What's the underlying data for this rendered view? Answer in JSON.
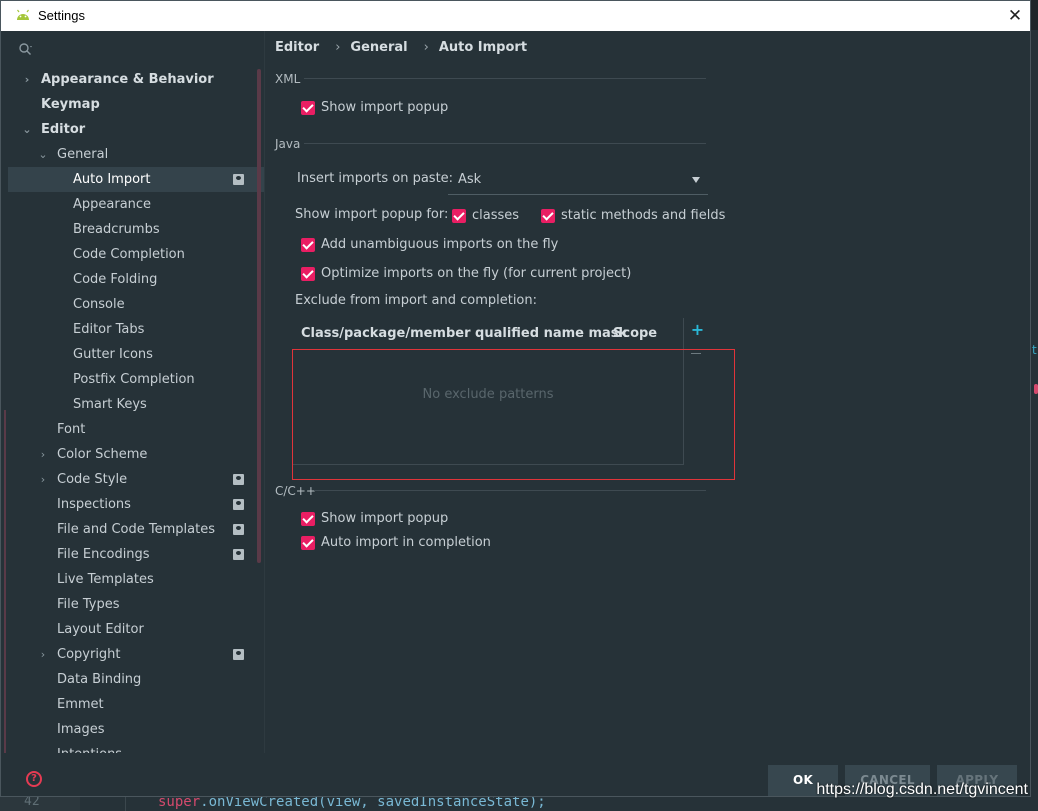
{
  "window": {
    "title": "Settings",
    "close_glyph": "✕"
  },
  "background": {
    "line_number": "42",
    "code_keyword": "super",
    "code_rest": ".onViewCreated(view, savedInstanceState);",
    "watermark": "https://blog.csdn.net/tgvincent",
    "right_peek_char": "t"
  },
  "sidebar": {
    "search_placeholder": "",
    "items": [
      {
        "label": "Appearance & Behavior",
        "level": 0,
        "arrow": "›",
        "bold": true
      },
      {
        "label": "Keymap",
        "level": 0,
        "arrow": "",
        "bold": true
      },
      {
        "label": "Editor",
        "level": 0,
        "arrow": "⌄",
        "bold": true
      },
      {
        "label": "General",
        "level": 1,
        "arrow": "⌄"
      },
      {
        "label": "Auto Import",
        "level": 2,
        "selected": true,
        "project": true
      },
      {
        "label": "Appearance",
        "level": 2
      },
      {
        "label": "Breadcrumbs",
        "level": 2
      },
      {
        "label": "Code Completion",
        "level": 2
      },
      {
        "label": "Code Folding",
        "level": 2
      },
      {
        "label": "Console",
        "level": 2
      },
      {
        "label": "Editor Tabs",
        "level": 2
      },
      {
        "label": "Gutter Icons",
        "level": 2
      },
      {
        "label": "Postfix Completion",
        "level": 2
      },
      {
        "label": "Smart Keys",
        "level": 2
      },
      {
        "label": "Font",
        "level": 1
      },
      {
        "label": "Color Scheme",
        "level": 1,
        "arrow": "›"
      },
      {
        "label": "Code Style",
        "level": 1,
        "arrow": "›",
        "project": true
      },
      {
        "label": "Inspections",
        "level": 1,
        "project": true
      },
      {
        "label": "File and Code Templates",
        "level": 1,
        "project": true
      },
      {
        "label": "File Encodings",
        "level": 1,
        "project": true
      },
      {
        "label": "Live Templates",
        "level": 1
      },
      {
        "label": "File Types",
        "level": 1
      },
      {
        "label": "Layout Editor",
        "level": 1
      },
      {
        "label": "Copyright",
        "level": 1,
        "arrow": "›",
        "project": true
      },
      {
        "label": "Data Binding",
        "level": 1
      },
      {
        "label": "Emmet",
        "level": 1
      },
      {
        "label": "Images",
        "level": 1
      },
      {
        "label": "Intentions",
        "level": 1
      }
    ]
  },
  "breadcrumb": {
    "parts": [
      "Editor",
      "General",
      "Auto Import"
    ],
    "separator": "›"
  },
  "xml": {
    "title": "XML",
    "show_import_popup": {
      "label": "Show import popup",
      "checked": true
    }
  },
  "java": {
    "title": "Java",
    "insert_imports_label": "Insert imports on paste:",
    "insert_imports_value": "Ask",
    "show_popup_for_label": "Show import popup for:",
    "classes": {
      "label": "classes",
      "checked": true
    },
    "static_methods": {
      "label": "static methods and fields",
      "checked": true
    },
    "add_unambiguous": {
      "label": "Add unambiguous imports on the fly",
      "checked": true
    },
    "optimize_imports": {
      "label": "Optimize imports on the fly (for current project)",
      "checked": true
    },
    "exclude_label": "Exclude from import and completion:",
    "table": {
      "columns": [
        "Class/package/member qualified name mask",
        "Scope"
      ],
      "empty_text": "No exclude patterns",
      "add_glyph": "+"
    }
  },
  "cpp": {
    "title": "C/C++",
    "show_import_popup": {
      "label": "Show import popup",
      "checked": true
    },
    "auto_import_completion": {
      "label": "Auto import in completion",
      "checked": true
    }
  },
  "footer": {
    "help_glyph": "?",
    "ok": "OK",
    "cancel": "CANCEL",
    "apply": "APPLY"
  },
  "colors": {
    "accent": "#e91e63",
    "background": "#263238",
    "selection": "#34434b",
    "annotation_box": "#e0343a",
    "add_icon": "#2ab7d6"
  }
}
